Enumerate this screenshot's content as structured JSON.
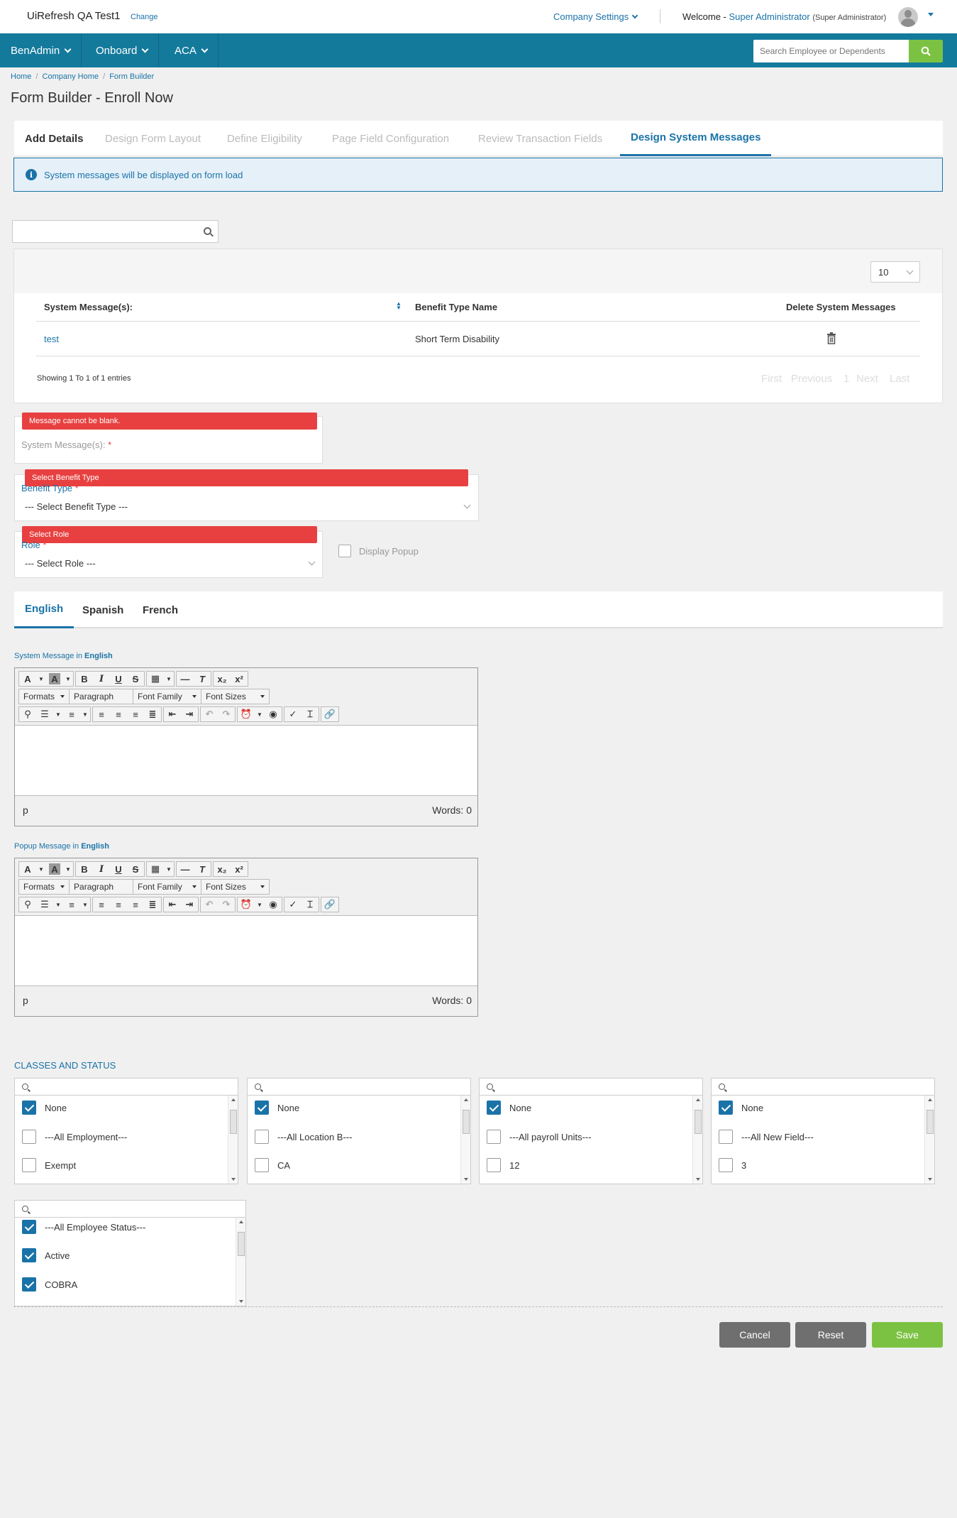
{
  "header": {
    "company_name": "UiRefresh QA Test1",
    "change_link": "Change",
    "company_settings": "Company Settings",
    "welcome_prefix": "Welcome -",
    "user_name": "Super Administrator",
    "user_role": "(Super Administrator)"
  },
  "nav": {
    "items": [
      {
        "label": "BenAdmin"
      },
      {
        "label": "Onboard"
      },
      {
        "label": "ACA"
      }
    ],
    "search_placeholder": "Search Employee or Dependents"
  },
  "breadcrumb": [
    "Home",
    "Company Home",
    "Form Builder"
  ],
  "page_title": "Form Builder - Enroll Now",
  "wizard_tabs": [
    {
      "label": "Add Details",
      "state": "done"
    },
    {
      "label": "Design Form Layout",
      "state": "disabled"
    },
    {
      "label": "Define Eligibility",
      "state": "disabled"
    },
    {
      "label": "Page Field Configuration",
      "state": "disabled"
    },
    {
      "label": "Review Transaction Fields",
      "state": "disabled"
    },
    {
      "label": "Design System Messages",
      "state": "active"
    }
  ],
  "info_message": "System messages will be displayed on form load",
  "table": {
    "search_value": "",
    "page_size": "10",
    "columns": [
      "System Message(s):",
      "Benefit Type Name",
      "Delete System Messages"
    ],
    "rows": [
      {
        "message": "test",
        "benefit_type": "Short Term Disability"
      }
    ],
    "showing": "Showing 1 To 1 of 1 entries",
    "pager": {
      "first": "First",
      "previous": "Previous",
      "page": "1",
      "next": "Next",
      "last": "Last"
    }
  },
  "form": {
    "message_error": "Message cannot be blank.",
    "message_label": "System Message(s):",
    "benefit_error": "Select Benefit Type",
    "benefit_label": "Benefit Type",
    "benefit_value": "--- Select Benefit Type ---",
    "role_error": "Select Role",
    "role_label": "Role",
    "role_value": "--- Select Role ---",
    "display_popup": "Display Popup",
    "required_mark": "*"
  },
  "languages": [
    {
      "label": "English",
      "active": true
    },
    {
      "label": "Spanish",
      "active": false
    },
    {
      "label": "French",
      "active": false
    }
  ],
  "editors": {
    "system_label_prefix": "System Message in",
    "popup_label_prefix": "Popup Message in",
    "language": "English",
    "formats": "Formats",
    "paragraph": "Paragraph",
    "font_family": "Font Family",
    "font_sizes": "Font Sizes",
    "status_path": "p",
    "words": "Words: 0"
  },
  "classes": {
    "title": "CLASSES AND STATUS",
    "lists": [
      {
        "items": [
          {
            "label": "None",
            "checked": true
          },
          {
            "label": "---All Employment---",
            "checked": false
          },
          {
            "label": "Exempt",
            "checked": false
          }
        ]
      },
      {
        "items": [
          {
            "label": "None",
            "checked": true
          },
          {
            "label": "---All Location B---",
            "checked": false
          },
          {
            "label": "CA",
            "checked": false
          }
        ]
      },
      {
        "items": [
          {
            "label": "None",
            "checked": true
          },
          {
            "label": "---All payroll Units---",
            "checked": false
          },
          {
            "label": "12",
            "checked": false
          }
        ]
      },
      {
        "items": [
          {
            "label": "None",
            "checked": true
          },
          {
            "label": "---All New Field---",
            "checked": false
          },
          {
            "label": "3",
            "checked": false
          }
        ]
      },
      {
        "items": [
          {
            "label": "---All Employee Status---",
            "checked": true
          },
          {
            "label": "Active",
            "checked": true
          },
          {
            "label": "COBRA",
            "checked": true
          }
        ]
      }
    ]
  },
  "actions": {
    "cancel": "Cancel",
    "reset": "Reset",
    "save": "Save"
  },
  "colors": {
    "brand": "#147a9c",
    "link": "#1a73a8",
    "error": "#e84040",
    "save": "#7cc242",
    "grey_button": "#6f6f6f"
  }
}
